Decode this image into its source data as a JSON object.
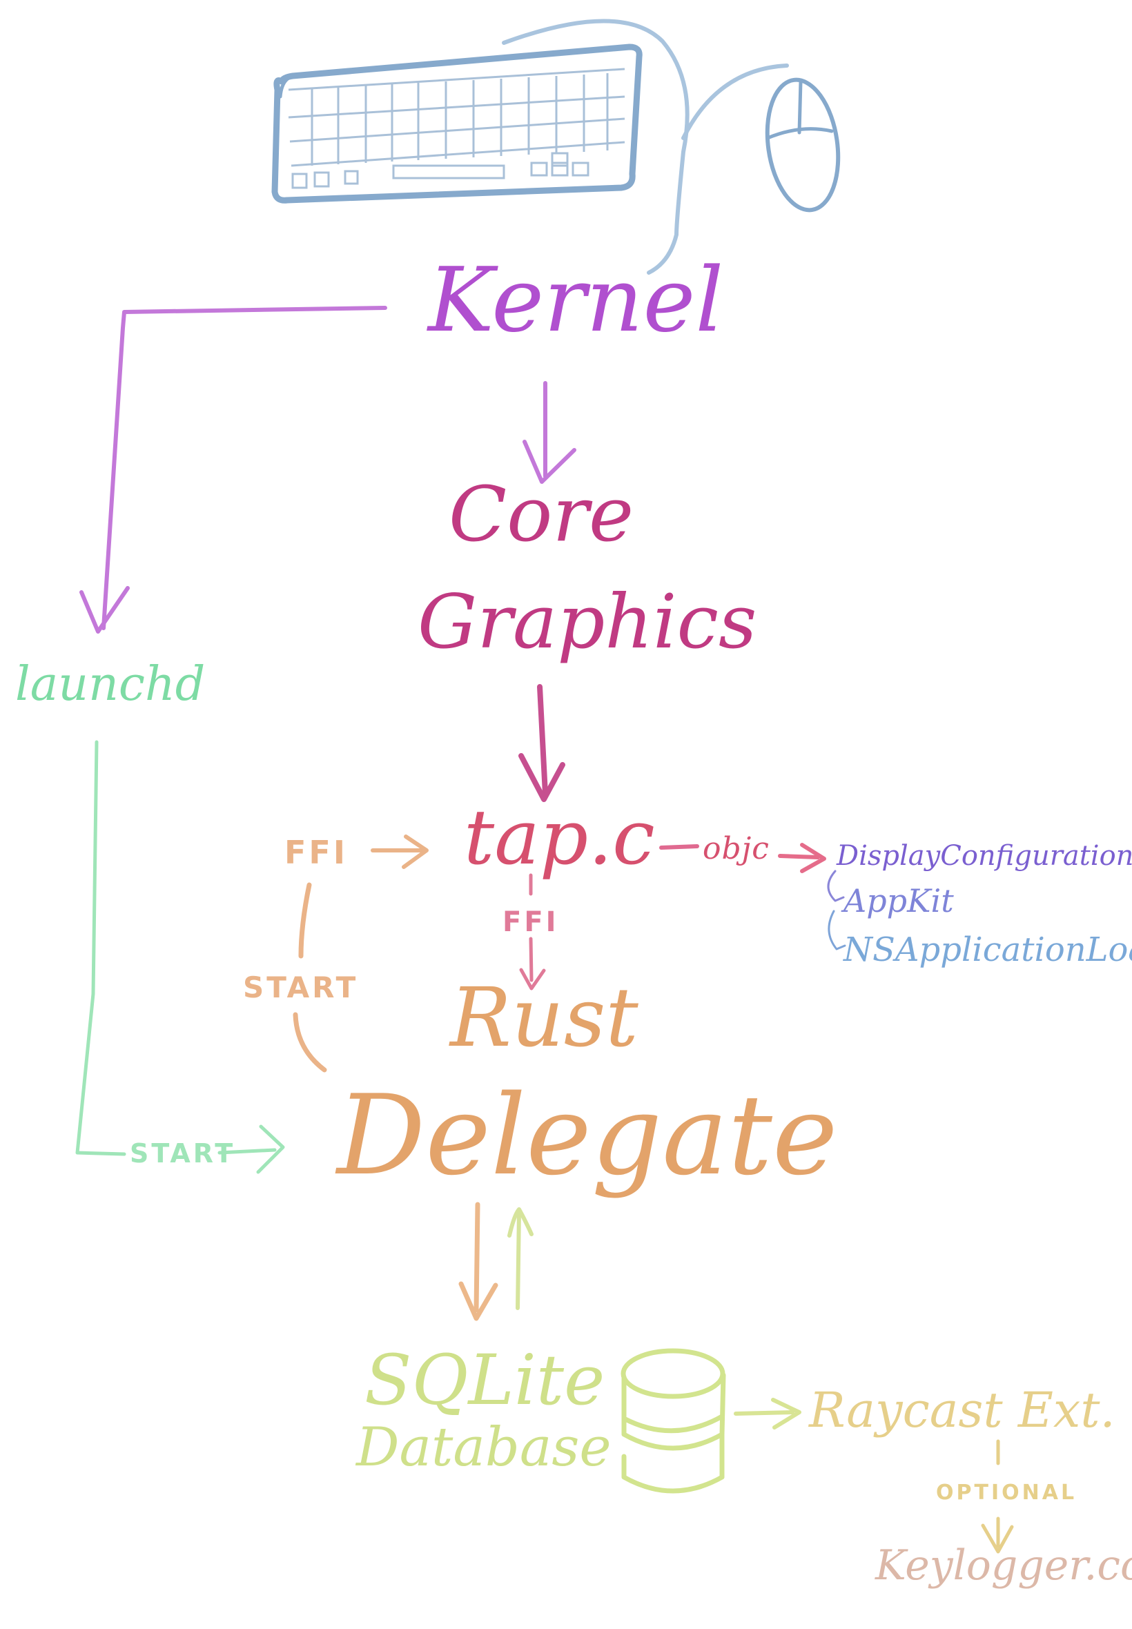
{
  "nodes": {
    "kernel": "Kernel",
    "core_graphics_line1": "Core",
    "core_graphics_line2": "Graphics",
    "launchd": "launchd",
    "tap_c": "tap.c",
    "rust": "Rust",
    "delegate": "Delegate",
    "sqlite_line1": "SQLite",
    "sqlite_line2": "Database",
    "display_config": "DisplayConfiguration.m",
    "appkit": "AppKit",
    "ns_application_load": "NSApplicationLoad",
    "raycast_ext": "Raycast Ext.",
    "keylogger_cool": "Keylogger.cool"
  },
  "edge_labels": {
    "ffi_into_tap": "FFI",
    "objc": "objc",
    "ffi_tap_to_rust": "FFI",
    "start_delegate_loop": "START",
    "start_launchd": "START",
    "optional": "OPTIONAL"
  },
  "icons": [
    "keyboard-icon",
    "mouse-icon",
    "database-cylinder-icon"
  ],
  "colors": {
    "kernel": "#b04fcf",
    "core_graphics": "#c03a82",
    "launchd": "#7ddba4",
    "tap_c": "#d6506e",
    "rust": "#e3a36a",
    "delegate": "#e3a36a",
    "sqlite": "#cfe08a",
    "display_config": "#7a5fd0",
    "appkit": "#7e84d8",
    "ns_application_load": "#7aa8d8",
    "raycast": "#e6cf8a",
    "keylogger": "#dcb8a8",
    "keyboard": "#86a9cc",
    "cable": "#a9c4de"
  }
}
